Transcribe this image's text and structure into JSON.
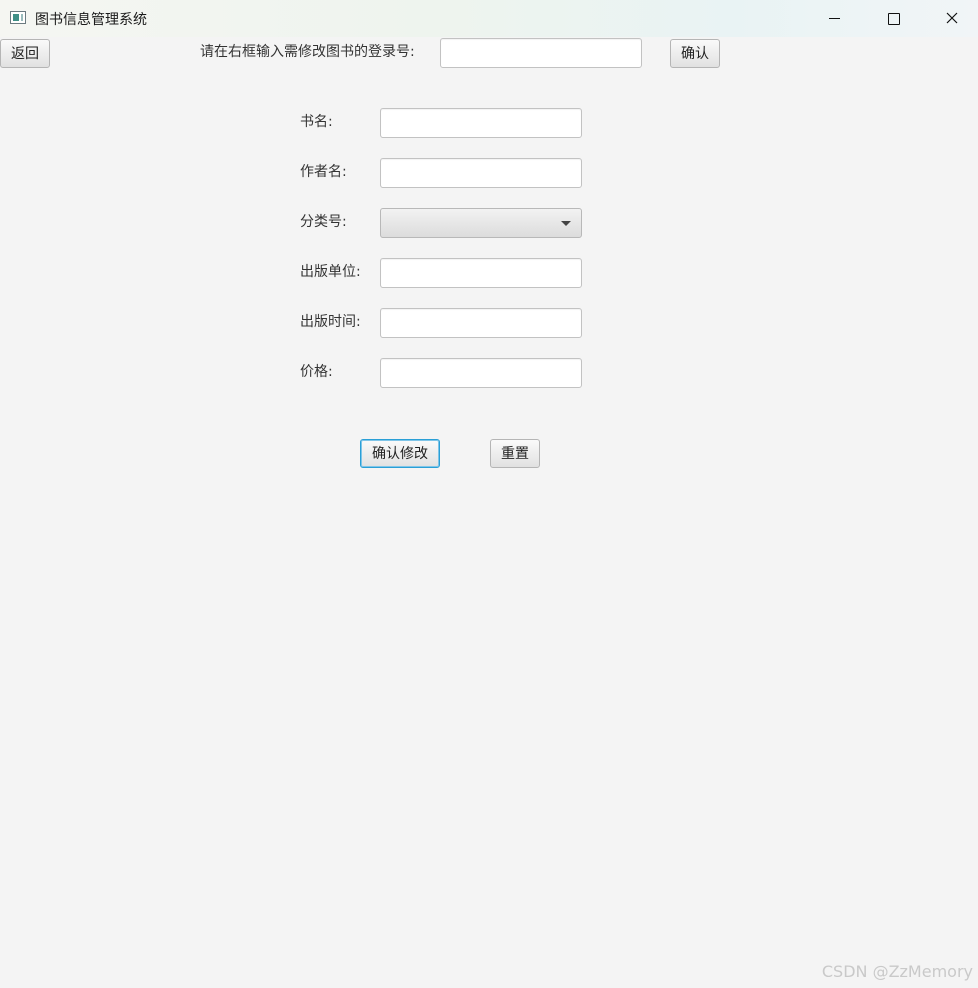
{
  "window": {
    "title": "图书信息管理系统"
  },
  "top": {
    "back_label": "返回",
    "prompt": "请在右框输入需修改图书的登录号:",
    "login_number_value": "",
    "confirm_label": "确认"
  },
  "form": {
    "fields": [
      {
        "label": "书名:",
        "value": ""
      },
      {
        "label": "作者名:",
        "value": ""
      },
      {
        "label": "分类号:",
        "value": ""
      },
      {
        "label": "出版单位:",
        "value": ""
      },
      {
        "label": "出版时间:",
        "value": ""
      },
      {
        "label": "价格:",
        "value": ""
      }
    ]
  },
  "actions": {
    "confirm_edit_label": "确认修改",
    "reset_label": "重置"
  },
  "watermark": "CSDN @ZzMemory",
  "colors": {
    "background": "#f4f4f4",
    "focus_border": "#2a9fd6"
  }
}
